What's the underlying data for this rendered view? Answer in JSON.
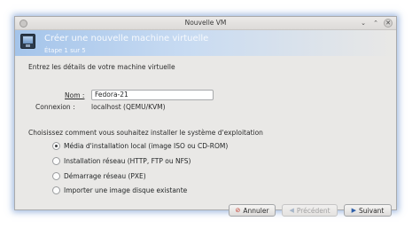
{
  "window": {
    "title": "Nouvelle VM",
    "buttons": {
      "minimize": "⌄",
      "maximize": "⌃",
      "close": "✕"
    }
  },
  "header": {
    "title": "Créer une nouvelle machine virtuelle",
    "step": "Étape 1 sur 5",
    "icon": "monitor-icon"
  },
  "details": {
    "intro": "Entrez les détails de votre machine virtuelle",
    "name_label": "Nom :",
    "name_value": "Fedora-21",
    "connection_label": "Connexion :",
    "connection_value": "localhost (QEMU/KVM)"
  },
  "install": {
    "question": "Choisissez comment vous souhaitez installer le système d'exploitation",
    "options": [
      {
        "label": "Média d'installation local (image ISO ou CD-ROM)",
        "checked": true
      },
      {
        "label": "Installation réseau (HTTP, FTP ou NFS)",
        "checked": false
      },
      {
        "label": "Démarrage réseau (PXE)",
        "checked": false
      },
      {
        "label": "Importer une image disque existante",
        "checked": false
      }
    ]
  },
  "footer": {
    "cancel": "Annuler",
    "previous": "Précédent",
    "next": "Suivant",
    "previous_enabled": false
  },
  "colors": {
    "header_gradient_start": "#a4c4ea",
    "window_bg": "#e9e8e6",
    "glow": "#789bd2"
  }
}
